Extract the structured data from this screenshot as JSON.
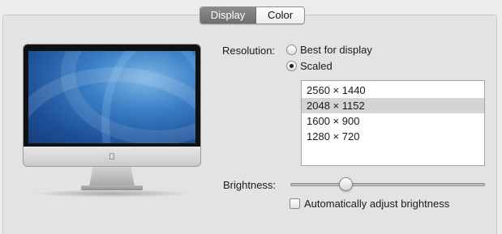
{
  "tabs": [
    {
      "label": "Display",
      "selected": true
    },
    {
      "label": "Color",
      "selected": false
    }
  ],
  "monitor": {
    "icon": "imac-icon",
    "logo": ""
  },
  "resolution": {
    "label": "Resolution:",
    "options": [
      {
        "label": "Best for display",
        "selected": false
      },
      {
        "label": "Scaled",
        "selected": true
      }
    ],
    "list": [
      {
        "label": "2560 × 1440",
        "selected": false
      },
      {
        "label": "2048 × 1152",
        "selected": true
      },
      {
        "label": "1600 × 900",
        "selected": false
      },
      {
        "label": "1280 × 720",
        "selected": false
      }
    ]
  },
  "brightness": {
    "label": "Brightness:",
    "value": 0.27,
    "auto_label": "Automatically adjust brightness",
    "auto_checked": false
  },
  "colors": {
    "selected_row": "#d4d4d4",
    "tab_active": "#7d7d7d"
  }
}
